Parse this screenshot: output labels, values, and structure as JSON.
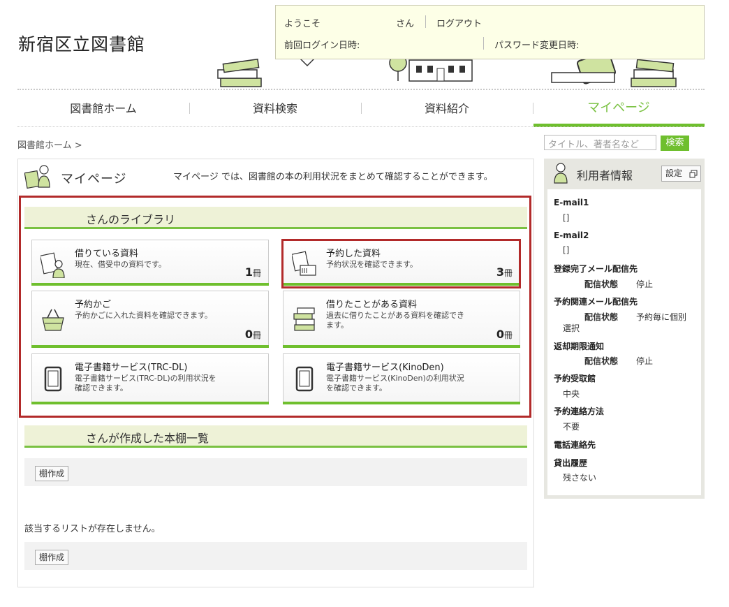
{
  "header": {
    "site_title": "新宿区立図書館",
    "welcome": "ようこそ",
    "san": "さん",
    "logout": "ログアウト",
    "last_login_label": "前回ログイン日時:",
    "password_changed_label": "パスワード変更日時:"
  },
  "nav": {
    "items": [
      "図書館ホーム",
      "資料検索",
      "資料紹介",
      "マイページ"
    ],
    "active_index": 3
  },
  "breadcrumb": {
    "home": "図書館ホーム",
    "separator": ">"
  },
  "search": {
    "placeholder": "タイトル、著者名など",
    "button": "検索"
  },
  "mypage": {
    "title": "マイページ",
    "description": "マイページ では、図書館の本の利用状況をまとめて確認することができます。"
  },
  "library": {
    "heading": "さんのライブラリ",
    "cards": [
      {
        "title": "借りている資料",
        "desc": "現在、借受中の資料です。",
        "count": "1",
        "unit": "冊",
        "icon": "borrowed-books-icon"
      },
      {
        "title": "予約した資料",
        "desc": "予約状況を確認できます。",
        "count": "3",
        "unit": "冊",
        "icon": "reserved-books-icon"
      },
      {
        "title": "予約かご",
        "desc": "予約かごに入れた資料を確認できます。",
        "count": "0",
        "unit": "冊",
        "icon": "basket-icon"
      },
      {
        "title": "借りたことがある資料",
        "desc": "過去に借りたことがある資料を確認できます。",
        "count": "0",
        "unit": "冊",
        "icon": "book-stack-icon"
      },
      {
        "title": "電子書籍サービス(TRC-DL)",
        "desc": "電子書籍サービス(TRC-DL)の利用状況を確認できます。",
        "icon": "tablet-icon"
      },
      {
        "title": "電子書籍サービス(KinoDen)",
        "desc": "電子書籍サービス(KinoDen)の利用状況を確認できます。",
        "icon": "tablet-icon"
      }
    ]
  },
  "bookshelf": {
    "heading": "さんが作成した本棚一覧",
    "create_button": "棚作成",
    "empty_message": "該当するリストが存在しません。"
  },
  "user_info": {
    "title": "利用者情報",
    "settings_button": "設定",
    "fields": [
      {
        "label": "E-mail1",
        "value": "[]"
      },
      {
        "label": "E-mail2",
        "value": "[]"
      },
      {
        "label": "登録完了メール配信先",
        "sub_label": "配信状態",
        "value": "停止"
      },
      {
        "label": "予約関連メール配信先",
        "sub_label": "配信状態",
        "value": "予約毎に個別",
        "value2": "選択"
      },
      {
        "label": "返却期限通知",
        "sub_label": "配信状態",
        "value": "停止"
      },
      {
        "label": "予約受取館",
        "value": "中央"
      },
      {
        "label": "予約連絡方法",
        "value": "不要"
      },
      {
        "label": "電話連絡先",
        "value": ""
      },
      {
        "label": "貸出履歴",
        "value": "残さない"
      }
    ]
  },
  "colors": {
    "accent": "#6fbf2e",
    "highlight": "#b22a2a",
    "logout": "#e07b00"
  }
}
